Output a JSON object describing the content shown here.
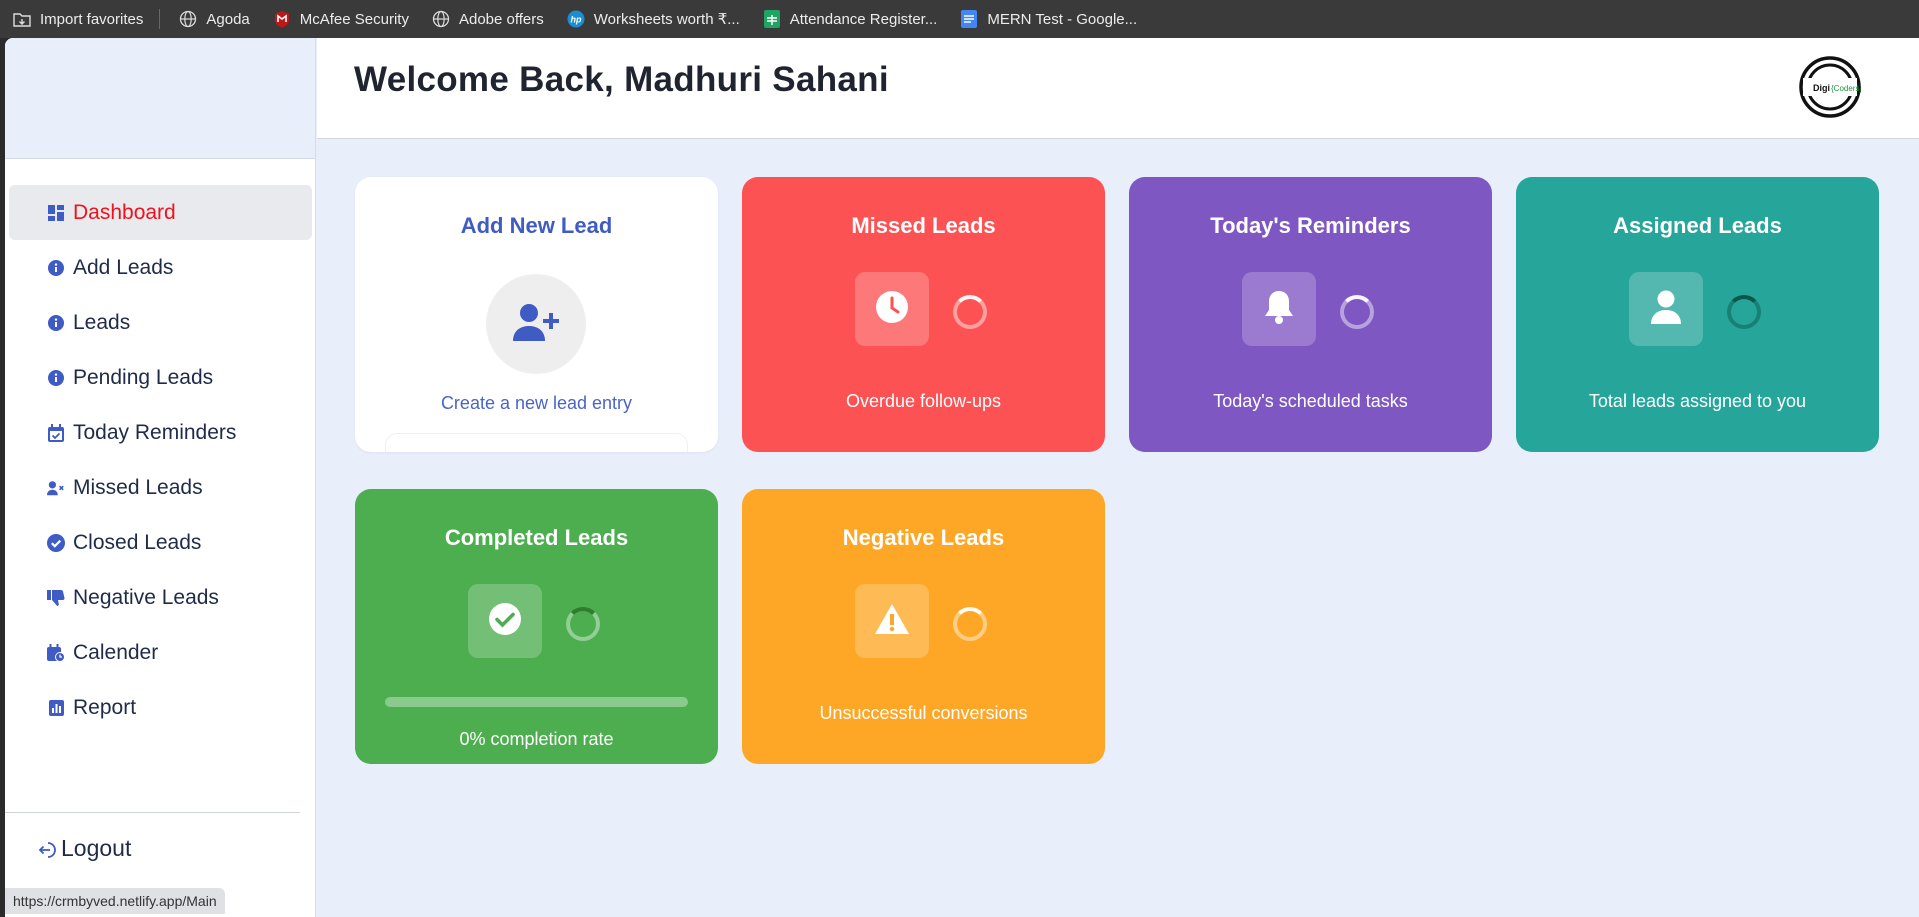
{
  "bookmarks": [
    {
      "label": "Import favorites",
      "icon": "import-icon"
    },
    {
      "label": "Agoda",
      "icon": "globe-icon"
    },
    {
      "label": "McAfee Security",
      "icon": "mcafee-icon"
    },
    {
      "label": "Adobe offers",
      "icon": "globe-icon"
    },
    {
      "label": "Worksheets worth ₹...",
      "icon": "hp-icon"
    },
    {
      "label": "Attendance Register...",
      "icon": "sheets-icon"
    },
    {
      "label": "MERN Test - Google...",
      "icon": "docs-icon"
    }
  ],
  "sidebar": {
    "items": [
      {
        "label": "Dashboard",
        "icon": "dashboard-icon",
        "active": true
      },
      {
        "label": "Add Leads",
        "icon": "info-icon"
      },
      {
        "label": "Leads",
        "icon": "info-icon"
      },
      {
        "label": "Pending Leads",
        "icon": "info-icon"
      },
      {
        "label": "Today Reminders",
        "icon": "calendar-check-icon"
      },
      {
        "label": "Missed Leads",
        "icon": "user-x-icon"
      },
      {
        "label": "Closed Leads",
        "icon": "check-circle-icon"
      },
      {
        "label": "Negative Leads",
        "icon": "thumbs-down-icon"
      },
      {
        "label": "Calender",
        "icon": "calendar-clock-icon"
      },
      {
        "label": "Report",
        "icon": "report-icon"
      }
    ],
    "logout": "Logout"
  },
  "header": {
    "welcome": "Welcome Back, Madhuri Sahani",
    "logo_text_1": "Digi",
    "logo_text_2": "{Coders}"
  },
  "cards": {
    "add_lead": {
      "title": "Add New Lead",
      "subtitle": "Create a new lead entry",
      "icon": "user-plus-icon"
    },
    "missed": {
      "title": "Missed Leads",
      "subtitle": "Overdue follow-ups",
      "icon": "clock-icon",
      "color": "#fd5254"
    },
    "reminders": {
      "title": "Today's Reminders",
      "subtitle": "Today's scheduled tasks",
      "icon": "bell-icon",
      "color": "#7f57c2"
    },
    "assigned": {
      "title": "Assigned Leads",
      "subtitle": "Total leads assigned to you",
      "icon": "user-icon",
      "color": "#26a59a"
    },
    "completed": {
      "title": "Completed Leads",
      "subtitle": "0% completion rate",
      "icon": "check-icon",
      "color": "#4cae4f",
      "progress": 0
    },
    "negative": {
      "title": "Negative Leads",
      "subtitle": "Unsuccessful conversions",
      "icon": "warning-icon",
      "color": "#fea726"
    }
  },
  "status_bar_url": "https://crmbyved.netlify.app/Main"
}
